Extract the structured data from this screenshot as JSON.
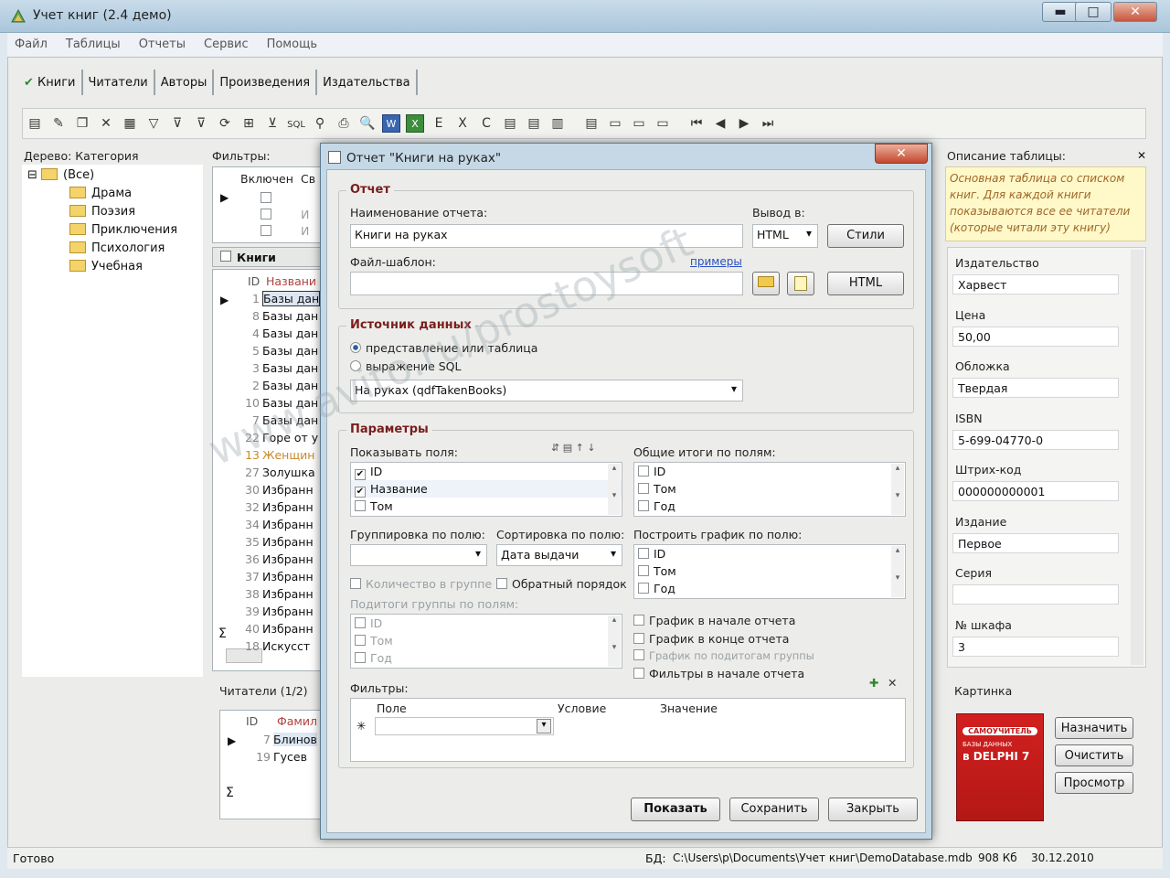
{
  "window": {
    "title": "Учет книг (2.4 демо)",
    "min": "▬",
    "max": "□",
    "close": "✕"
  },
  "menu": [
    "Файл",
    "Таблицы",
    "Отчеты",
    "Сервис",
    "Помощь"
  ],
  "tabs": [
    "Книги",
    "Читатели",
    "Авторы",
    "Произведения",
    "Издательства"
  ],
  "toolbar_icons": [
    "new-record-icon",
    "edit-icon",
    "copy-icon",
    "delete-icon",
    "delete-all-icon",
    "filter-icon",
    "filter-clear-icon",
    "filter-off-icon",
    "refresh-icon",
    "tree-icon",
    "filter-apply-icon",
    "sql-icon",
    "binoculars-icon",
    "print-icon",
    "preview-icon",
    "word-icon",
    "excel-icon",
    "export1-icon",
    "export2-icon",
    "export3-icon",
    "export4-icon",
    "export5-icon",
    "chart-icon",
    "import-icon",
    "window1-icon",
    "window2-icon",
    "window3-icon",
    "first-icon",
    "prev-icon",
    "next-icon",
    "last-icon"
  ],
  "toolbar_glyphs": [
    "▤",
    "✎",
    "❐",
    "✕",
    "▦",
    "▽",
    "⊽",
    "⊽",
    "⟳",
    "⊞",
    "⊻",
    "SQL",
    "⚲",
    "⎙",
    "🔍",
    "W",
    "X",
    "E",
    "X",
    "C",
    "▤",
    "▤",
    "▥",
    "▤",
    "▭",
    "▭",
    "▭",
    "⏮",
    "◀",
    "▶",
    "⏭"
  ],
  "tree": {
    "header": "Дерево: Категория",
    "root": "(Все)",
    "items": [
      "Драма",
      "Поэзия",
      "Приключения",
      "Психология",
      "Учебная"
    ],
    "expander": "⊟"
  },
  "filters": {
    "header": "Фильтры:",
    "col_enabled": "Включен",
    "col_field": "Св",
    "rows_extra": [
      "И",
      "И"
    ]
  },
  "books": {
    "header": "Книги",
    "col_id": "ID",
    "col_name": "Названи",
    "rows": [
      {
        "id": "1",
        "name": "Базы дан"
      },
      {
        "id": "8",
        "name": "Базы дан"
      },
      {
        "id": "4",
        "name": "Базы дан"
      },
      {
        "id": "5",
        "name": "Базы дан"
      },
      {
        "id": "3",
        "name": "Базы дан"
      },
      {
        "id": "2",
        "name": "Базы дан"
      },
      {
        "id": "10",
        "name": "Базы дан"
      },
      {
        "id": "7",
        "name": "Базы дан"
      },
      {
        "id": "22",
        "name": "Горе от у"
      },
      {
        "id": "13",
        "name": "Женщин"
      },
      {
        "id": "27",
        "name": "Золушка"
      },
      {
        "id": "30",
        "name": "Избранн"
      },
      {
        "id": "32",
        "name": "Избранн"
      },
      {
        "id": "34",
        "name": "Избранн"
      },
      {
        "id": "35",
        "name": "Избранн"
      },
      {
        "id": "36",
        "name": "Избранн"
      },
      {
        "id": "37",
        "name": "Избранн"
      },
      {
        "id": "38",
        "name": "Избранн"
      },
      {
        "id": "39",
        "name": "Избранн"
      },
      {
        "id": "40",
        "name": "Избранн"
      },
      {
        "id": "18",
        "name": "Искусст"
      }
    ],
    "sigma": "Σ"
  },
  "readers": {
    "tab": "Читатели (1/2)",
    "col_id": "ID",
    "col_name": "Фамил",
    "rows": [
      {
        "id": "7",
        "name": "Блинов"
      },
      {
        "id": "19",
        "name": "Гусев"
      }
    ],
    "sigma": "Σ"
  },
  "dialog": {
    "title": "Отчет \"Книги на руках\"",
    "close": "✕",
    "report_group": "Отчет",
    "name_label": "Наименование отчета:",
    "name_value": "Книги на руках",
    "output_label": "Вывод в:",
    "output_value": "HTML",
    "styles_btn": "Стили",
    "template_label": "Файл-шаблон:",
    "examples_link": "примеры",
    "template_value": "",
    "html_btn": "HTML",
    "source_group": "Источник данных",
    "radio_view": "представление или таблица",
    "radio_sql": "выражение SQL",
    "source_value": "На руках (qdfTakenBooks)",
    "params_group": "Параметры",
    "show_fields_label": "Показывать поля:",
    "show_fields": [
      {
        "label": "ID",
        "checked": true
      },
      {
        "label": "Название",
        "checked": true
      },
      {
        "label": "Том",
        "checked": false
      }
    ],
    "totals_label": "Общие итоги по полям:",
    "totals_fields": [
      "ID",
      "Том",
      "Год"
    ],
    "group_label": "Группировка по полю:",
    "group_value": "",
    "sort_label": "Сортировка по полю:",
    "sort_value": "Дата выдачи",
    "chart_label": "Построить график по полю:",
    "chart_fields": [
      "ID",
      "Том",
      "Год"
    ],
    "count_in_group": "Количество в группе",
    "reverse_order": "Обратный порядок",
    "subtotals_label": "Подитоги группы по полям:",
    "subtotals_fields": [
      "ID",
      "Том",
      "Год"
    ],
    "chart_start": "График в начале отчета",
    "chart_end": "График в конце отчета",
    "chart_subtotals": "График по подитогам группы",
    "filters_start": "Фильтры в начале отчета",
    "filters_label": "Фильтры:",
    "filter_cols": [
      "Поле",
      "Условие",
      "Значение"
    ],
    "filter_row_marker": "✳",
    "btn_show": "Показать",
    "btn_save": "Сохранить",
    "btn_close": "Закрыть"
  },
  "description": {
    "header": "Описание таблицы:",
    "close": "✕",
    "text": "Основная таблица со списком книг. Для каждой книги показываются все ее читатели (которые читали эту книгу)"
  },
  "details": [
    {
      "label": "Издательство",
      "value": "Харвест"
    },
    {
      "label": "Цена",
      "value": "50,00"
    },
    {
      "label": "Обложка",
      "value": "Твердая"
    },
    {
      "label": "ISBN",
      "value": "5-699-04770-0"
    },
    {
      "label": "Штрих-код",
      "value": "000000000001"
    },
    {
      "label": "Издание",
      "value": "Первое"
    },
    {
      "label": "Серия",
      "value": ""
    },
    {
      "label": "№ шкафа",
      "value": "3"
    }
  ],
  "picture": {
    "tab": "Картинка",
    "btn_assign": "Назначить",
    "btn_clear": "Очистить",
    "btn_view": "Просмотр",
    "cover_line1": "САМОУЧИТЕЛЬ",
    "cover_line2": "БАЗЫ ДАННЫХ",
    "cover_line3": "в DELPHI 7"
  },
  "status": {
    "ready": "Готово",
    "db_label": "БД:",
    "db_path": "C:\\Users\\p\\Documents\\Учет книг\\DemoDatabase.mdb",
    "size": "908 Кб",
    "date": "30.12.2010"
  },
  "watermark": "www.avito.ru/prostoysoft"
}
